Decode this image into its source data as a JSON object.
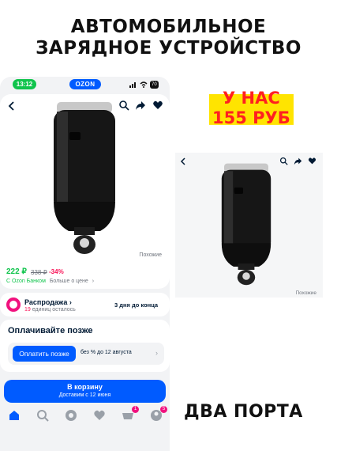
{
  "headline": {
    "line1": "АВТОМОБИЛЬНОЕ",
    "line2": "ЗАРЯДНОЕ УСТРОЙСТВО"
  },
  "phone": {
    "status_bar": {
      "time": "13:12",
      "app_logo": "OZON",
      "battery": "70"
    },
    "product": {
      "similar_label": "Похожие",
      "price": "222 ₽",
      "old_price": "338 ₽",
      "discount": "-34%",
      "bank_label": "С Ozon Банком",
      "price_more": "Больше о цене"
    },
    "sale": {
      "title": "Распродажа",
      "units_count": "19",
      "units_label": "единиц осталось",
      "ends_in": "3 дня до конца"
    },
    "pay_later": {
      "title": "Оплачивайте позже",
      "button": "Оплатить позже",
      "note": "без % до 12 августа"
    },
    "cart": {
      "label": "В корзину",
      "delivery": "Доставим с 12 июня"
    },
    "tabbar": {
      "cart_badge": "1",
      "profile_badge": "5"
    }
  },
  "promo": {
    "line1": "У НАС",
    "line2": "155 РУБ"
  },
  "second_photo": {
    "similar_label": "Похожие"
  },
  "footer_caption": "ДВА ПОРТА",
  "colors": {
    "brand_blue": "#005bff",
    "price_green": "#10c44c",
    "discount_pink": "#f91155",
    "promo_red": "#ff2020",
    "promo_yellow": "#ffe400"
  }
}
